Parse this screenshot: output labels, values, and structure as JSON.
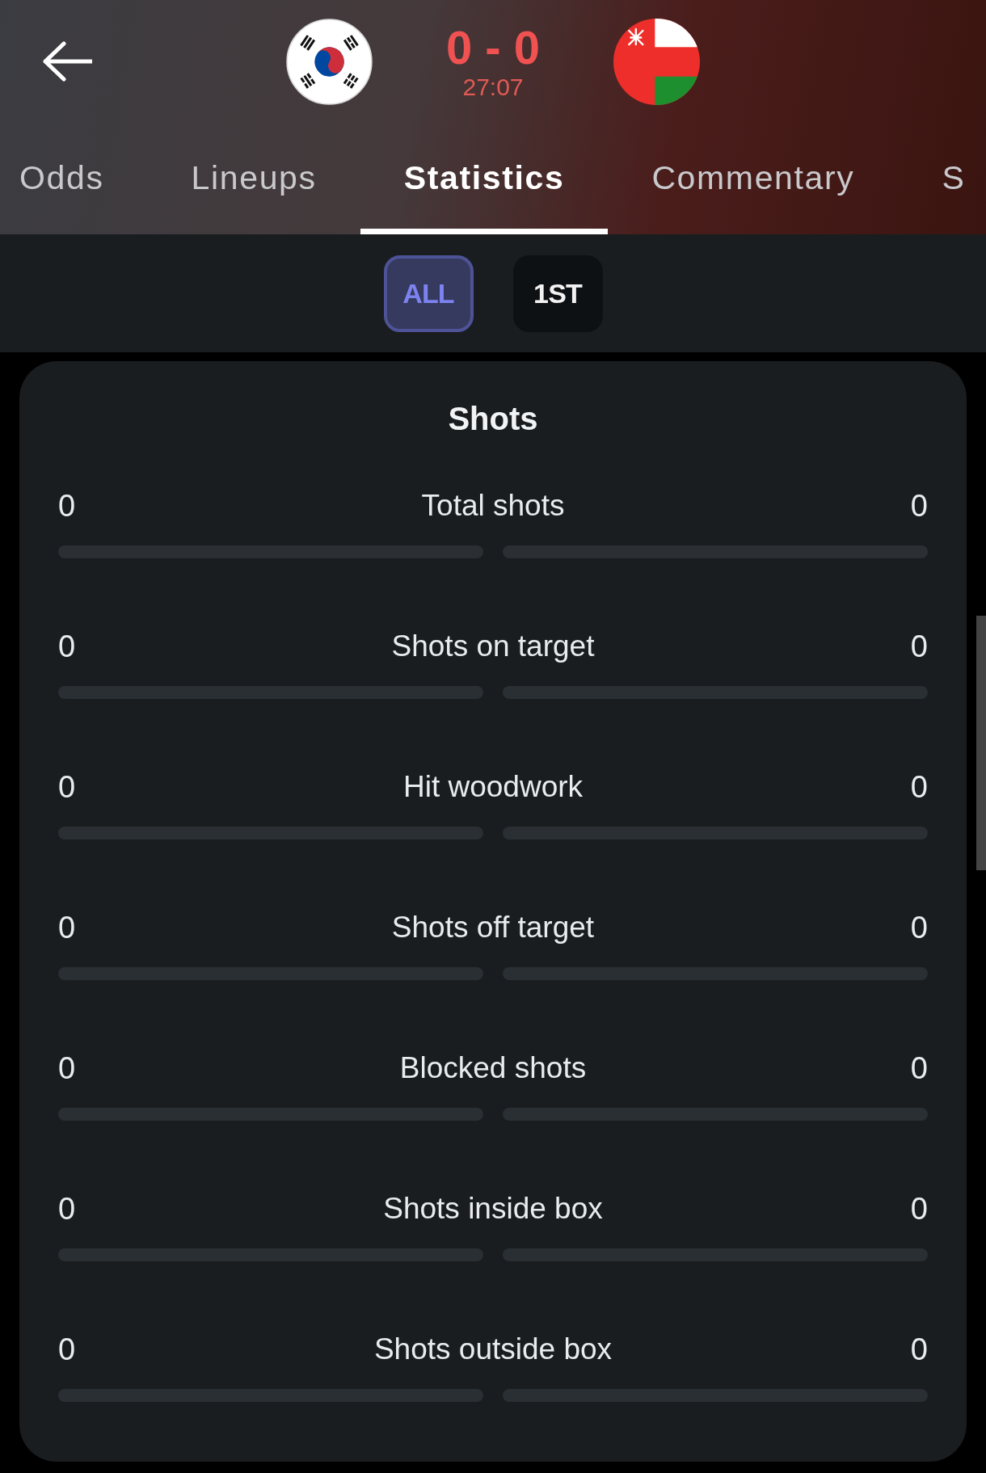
{
  "match": {
    "score": "0 - 0",
    "clock": "27:07"
  },
  "tabs": [
    {
      "label": "Odds",
      "selected": false
    },
    {
      "label": "Lineups",
      "selected": false
    },
    {
      "label": "Statistics",
      "selected": true
    },
    {
      "label": "Commentary",
      "selected": false
    },
    {
      "label": "S",
      "selected": false
    }
  ],
  "period_filters": [
    {
      "label": "ALL",
      "selected": true
    },
    {
      "label": "1ST",
      "selected": false
    }
  ],
  "section": {
    "title": "Shots",
    "stats": [
      {
        "label": "Total shots",
        "home": "0",
        "away": "0",
        "home_bar": {
          "level": 0
        },
        "away_bar": {
          "level": 0
        }
      },
      {
        "label": "Shots on target",
        "home": "0",
        "away": "0",
        "home_bar": {
          "level": 0
        },
        "away_bar": {
          "level": 0
        }
      },
      {
        "label": "Hit woodwork",
        "home": "0",
        "away": "0",
        "home_bar": {
          "level": 0
        },
        "away_bar": {
          "level": 0
        }
      },
      {
        "label": "Shots off target",
        "home": "0",
        "away": "0",
        "home_bar": {
          "level": 0
        },
        "away_bar": {
          "level": 0
        }
      },
      {
        "label": "Blocked shots",
        "home": "0",
        "away": "0",
        "home_bar": {
          "level": 0
        },
        "away_bar": {
          "level": 0
        }
      },
      {
        "label": "Shots inside box",
        "home": "0",
        "away": "0",
        "home_bar": {
          "level": 0
        },
        "away_bar": {
          "level": 0
        }
      },
      {
        "label": "Shots outside box",
        "home": "0",
        "away": "0",
        "home_bar": {
          "level": 0
        },
        "away_bar": {
          "level": 0
        }
      }
    ]
  }
}
